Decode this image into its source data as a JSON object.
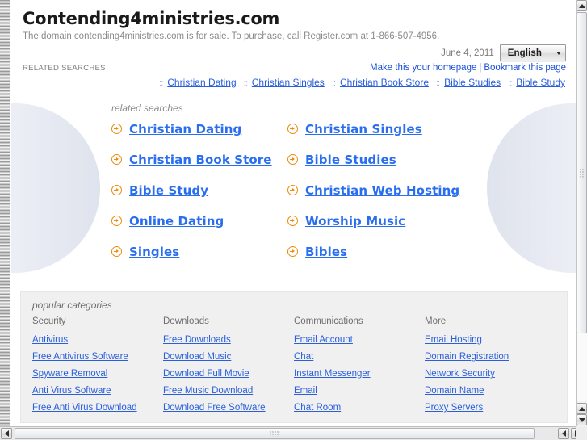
{
  "header": {
    "site_title": "Contending4ministries.com",
    "tagline": "The domain contending4ministries.com is for sale. To purchase, call Register.com at 1-866-507-4956.",
    "date": "June 4, 2011",
    "language": {
      "selected": "English",
      "dropdown_icon": "chevron-down-icon"
    },
    "related_searches_label": "RELATED SEARCHES",
    "actions": {
      "homepage": "Make this your homepage",
      "separator": "|",
      "bookmark": "Bookmark this page"
    },
    "top_links": [
      "Christian Dating",
      "Christian Singles",
      "Christian Book Store",
      "Bible Studies",
      "Bible Study"
    ],
    "link_dots": "::"
  },
  "main": {
    "caption": "related searches",
    "bullet_icon": "circle-arrow-right-icon",
    "links": [
      "Christian Dating",
      "Christian Singles",
      "Christian Book Store",
      "Bible Studies",
      "Bible Study",
      "Christian Web Hosting",
      "Online Dating",
      "Worship Music",
      "Singles",
      "Bibles"
    ]
  },
  "categories": {
    "caption": "popular categories",
    "columns": [
      {
        "title": "Security",
        "links": [
          "Antivirus",
          "Free Antivirus Software",
          "Spyware Removal",
          "Anti Virus Software",
          "Free Anti Virus Download"
        ]
      },
      {
        "title": "Downloads",
        "links": [
          "Free Downloads",
          "Download Music",
          "Download Full Movie",
          "Free Music Download",
          "Download Free Software"
        ]
      },
      {
        "title": "Communications",
        "links": [
          "Email Account",
          "Chat",
          "Instant Messenger",
          "Email",
          "Chat Room"
        ]
      },
      {
        "title": "More",
        "links": [
          "Email Hosting",
          "Domain Registration",
          "Network Security",
          "Domain Name",
          "Proxy Servers"
        ]
      }
    ]
  },
  "colors": {
    "link_blue": "#2a5fdb",
    "main_link_blue": "#2a6ef0",
    "bullet_orange": "#ef8a0a",
    "title_black": "#1a1a1a",
    "muted_gray": "#8a8a8a",
    "panel_gray": "#f0f0f0"
  },
  "scrollbars": {
    "v_up_icon": "triangle-up-icon",
    "v_down_icon": "triangle-down-icon",
    "h_left_icon": "triangle-left-icon",
    "h_right_icon": "triangle-right-icon"
  }
}
